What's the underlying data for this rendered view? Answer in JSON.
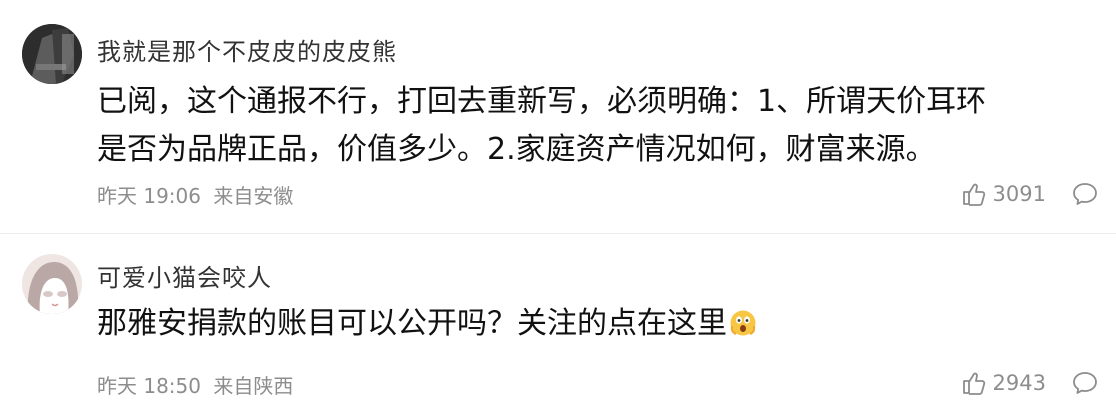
{
  "comments": [
    {
      "username": "我就是那个不皮皮的皮皮熊",
      "text": "已阅，这个通报不行，打回去重新写，必须明确：1、所谓天价耳环是否为品牌正品，价值多少。2.家庭资产情况如何，财富来源。",
      "time": "昨天 19:06",
      "location": "来自安徽",
      "likes": "3091",
      "avatar": "dark-photo-avatar"
    },
    {
      "username": "可爱小猫会咬人",
      "text": "那雅安捐款的账目可以公开吗？关注的点在这里",
      "emoji": "shocked-face-emoji",
      "time": "昨天 18:50",
      "location": "来自陕西",
      "likes": "2943",
      "avatar": "cartoon-cat-girl-avatar"
    }
  ],
  "colors": {
    "meta_text": "#8d8d8d",
    "content_text": "#111111",
    "divider": "#ececec"
  }
}
